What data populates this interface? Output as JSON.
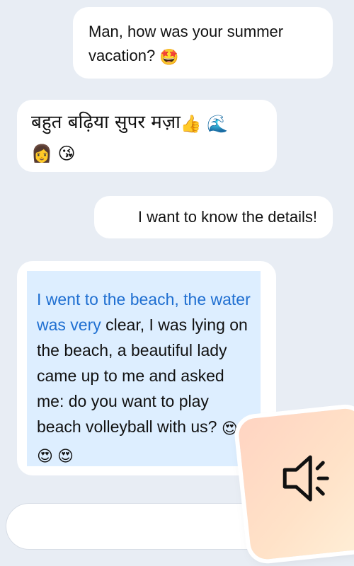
{
  "messages": [
    {
      "sender": "self",
      "text": "Man, how was your summer vacation?",
      "emoji": "🤩"
    },
    {
      "sender": "other",
      "text": "बहुत बढ़िया सुपर मज़ा",
      "emoji_line1": "👍 🌊",
      "emoji_line2": "👩 😘"
    },
    {
      "sender": "self",
      "text": "I want to know the details!"
    },
    {
      "sender": "other",
      "highlight_text": "I went to the beach, the water was very",
      "text": " clear, I was lying on the beach, a beautiful lady came up to me and asked me: do you want to play beach volleyball with us?",
      "emoji": "😍 😍 😍"
    }
  ],
  "input": {
    "value": ""
  },
  "speaker": {
    "icon": "speaker-icon"
  },
  "colors": {
    "background": "#e8edf4",
    "bubble": "#ffffff",
    "translation_bg": "#ddeeff",
    "highlight": "#1f6fd1"
  }
}
